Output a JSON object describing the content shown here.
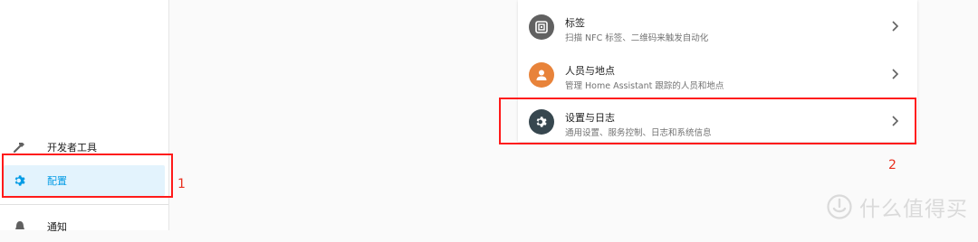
{
  "sidebar": {
    "items": [
      {
        "label": "开发者工具",
        "icon": "hammer-icon"
      },
      {
        "label": "配置",
        "icon": "gear-icon",
        "active": true
      },
      {
        "label": "通知",
        "icon": "bell-icon"
      }
    ]
  },
  "settings": {
    "rows": [
      {
        "title": "标签",
        "desc": "扫描 NFC 标签、二维码来触发自动化",
        "icon": "nfc-tag-icon",
        "color": "#616161"
      },
      {
        "title": "人员与地点",
        "desc": "管理 Home Assistant 跟踪的人员和地点",
        "icon": "person-icon",
        "color": "#e8833a"
      },
      {
        "title": "设置与日志",
        "desc": "通用设置、服务控制、日志和系统信息",
        "icon": "gear-icon",
        "color": "#37474f"
      }
    ]
  },
  "annotations": {
    "step1": "1",
    "step2": "2",
    "color": "#ff1a1a"
  },
  "watermark": {
    "text": "什么值得买"
  },
  "colors": {
    "accent": "#039be5",
    "active_bg": "#e3f3fd"
  }
}
